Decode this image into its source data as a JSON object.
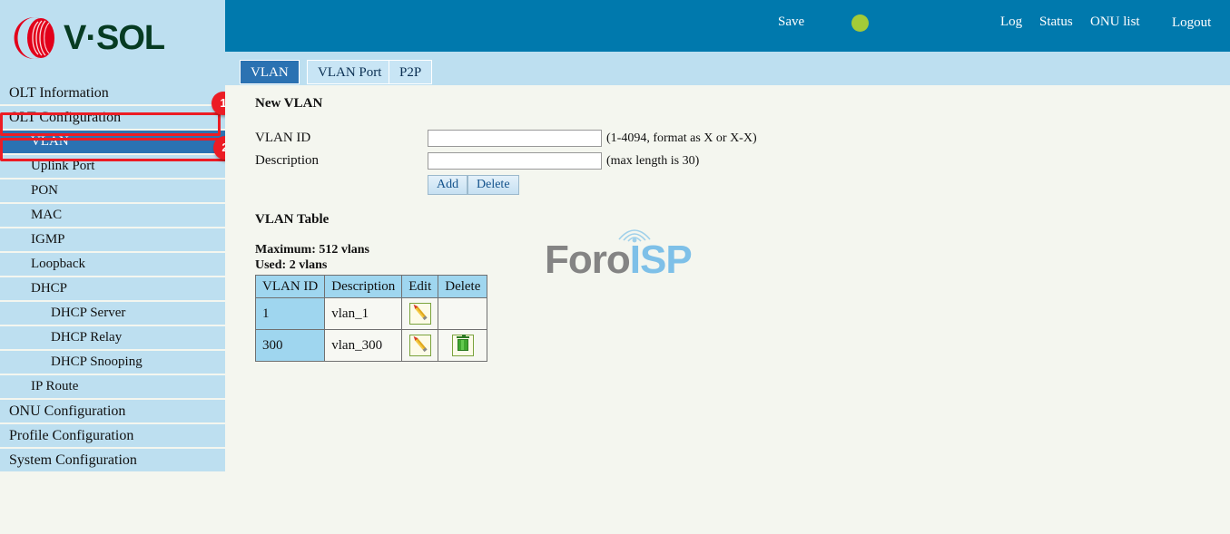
{
  "brand": {
    "logo_alt": "vsol-logo",
    "wordmark": "V·SOL"
  },
  "header": {
    "save_label": "Save",
    "save_indicator_color": "#a3cb38",
    "links": [
      {
        "label": "Log"
      },
      {
        "label": "Status"
      },
      {
        "label": "ONU list"
      },
      {
        "label": "Logout"
      }
    ]
  },
  "tabs": [
    {
      "label": "VLAN",
      "active": true
    },
    {
      "label": "VLAN Port",
      "active": false
    },
    {
      "label": "P2P",
      "active": false
    }
  ],
  "sidebar": {
    "items": [
      {
        "label": "OLT Information",
        "level": 0,
        "selected": false
      },
      {
        "label": "OLT Configuration",
        "level": 0,
        "selected": false
      },
      {
        "label": "VLAN",
        "level": 1,
        "selected": true
      },
      {
        "label": "Uplink Port",
        "level": 1,
        "selected": false
      },
      {
        "label": "PON",
        "level": 1,
        "selected": false
      },
      {
        "label": "MAC",
        "level": 1,
        "selected": false
      },
      {
        "label": "IGMP",
        "level": 1,
        "selected": false
      },
      {
        "label": "Loopback",
        "level": 1,
        "selected": false
      },
      {
        "label": "DHCP",
        "level": 1,
        "selected": false
      },
      {
        "label": "DHCP Server",
        "level": 2,
        "selected": false
      },
      {
        "label": "DHCP Relay",
        "level": 2,
        "selected": false
      },
      {
        "label": "DHCP Snooping",
        "level": 2,
        "selected": false
      },
      {
        "label": "IP Route",
        "level": 1,
        "selected": false
      },
      {
        "label": "ONU Configuration",
        "level": 0,
        "selected": false
      },
      {
        "label": "Profile Configuration",
        "level": 0,
        "selected": false
      },
      {
        "label": "System Configuration",
        "level": 0,
        "selected": false
      }
    ]
  },
  "annotations": {
    "color": "#ec1c24",
    "badges": [
      {
        "number": "1",
        "target": "OLT Configuration"
      },
      {
        "number": "2",
        "target": "VLAN"
      }
    ]
  },
  "main": {
    "new_vlan": {
      "title": "New VLAN",
      "vlan_id_label": "VLAN ID",
      "vlan_id_value": "",
      "vlan_id_hint": "(1-4094, format as X or X-X)",
      "description_label": "Description",
      "description_value": "",
      "description_hint": "(max length is 30)",
      "add_label": "Add",
      "delete_label": "Delete"
    },
    "vlan_table": {
      "title": "VLAN Table",
      "maximum_text": "Maximum: 512 vlans",
      "used_text": "Used: 2 vlans",
      "columns": [
        "VLAN ID",
        "Description",
        "Edit",
        "Delete"
      ],
      "rows": [
        {
          "vlan_id": "1",
          "description": "vlan_1",
          "edit": true,
          "delete": false
        },
        {
          "vlan_id": "300",
          "description": "vlan_300",
          "edit": true,
          "delete": true
        }
      ]
    }
  },
  "watermark": {
    "part1": "Foro",
    "part2": "ISP",
    "part1_color": "#848484",
    "part2_color": "#7ec0e8"
  }
}
